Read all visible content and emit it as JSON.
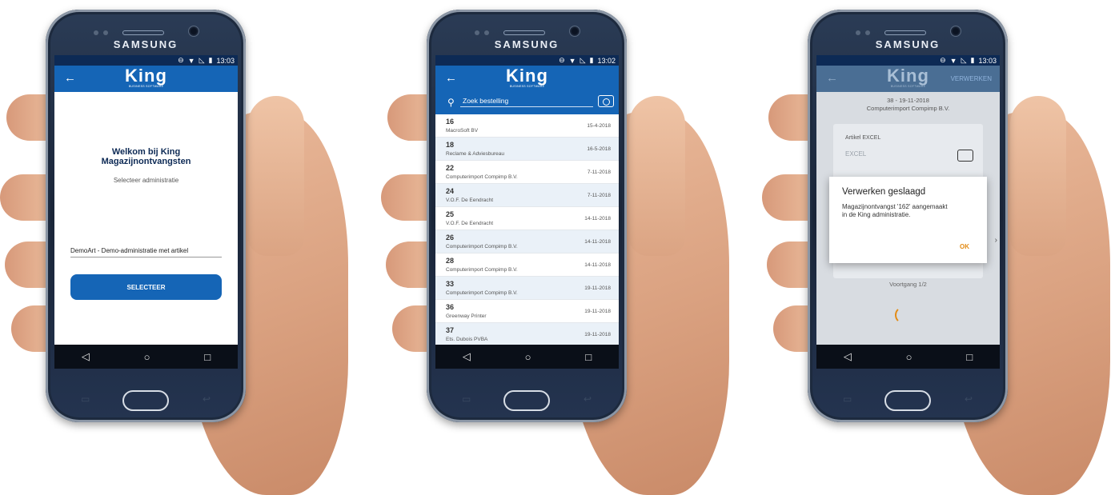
{
  "brand": "SAMSUNG",
  "app_logo": {
    "name": "King",
    "tagline": "BUSINESS SOFTWARE"
  },
  "colors": {
    "appbar": "#1565b6",
    "statusbar": "#0d2a55",
    "accent": "#e38b15",
    "row_alt": "#eaf1f8"
  },
  "icons": {
    "back": "back-arrow-icon",
    "search": "search-icon",
    "camera": "camera-icon"
  },
  "phones": [
    {
      "time": "13:03",
      "welcome_line1": "Welkom bij King",
      "welcome_line2": "Magazijnontvangsten",
      "hint": "Selecteer administratie",
      "selected_admin": "DemoArt - Demo-administratie met artikel",
      "select_button": "SELECTEER"
    },
    {
      "time": "13:02",
      "search_placeholder": "Zoek bestelling",
      "orders": [
        {
          "number": "16",
          "customer": "MacroSoft BV",
          "date": "15-4-2018"
        },
        {
          "number": "18",
          "customer": "Reclame & Adviesbureau",
          "date": "16-5-2018"
        },
        {
          "number": "22",
          "customer": "Computerimport Compimp B.V.",
          "date": "7-11-2018"
        },
        {
          "number": "24",
          "customer": "V.O.F. De Eendracht",
          "date": "7-11-2018"
        },
        {
          "number": "25",
          "customer": "V.O.F. De Eendracht",
          "date": "14-11-2018"
        },
        {
          "number": "26",
          "customer": "Computerimport Compimp B.V.",
          "date": "14-11-2018"
        },
        {
          "number": "28",
          "customer": "Computerimport Compimp B.V.",
          "date": "14-11-2018"
        },
        {
          "number": "33",
          "customer": "Computerimport Compimp B.V.",
          "date": "19-11-2018"
        },
        {
          "number": "36",
          "customer": "Greenway Printer",
          "date": "19-11-2018"
        },
        {
          "number": "37",
          "customer": "Ets. Dubois PVBA",
          "date": "19-11-2018"
        }
      ]
    },
    {
      "time": "13:03",
      "action": "VERWERKEN",
      "order_line": "38 - 19-11-2018",
      "customer": "Computerimport Compimp B.V.",
      "article_label": "Artikel EXCEL",
      "article_value": "EXCEL",
      "progress": "Voortgang 1/2",
      "dialog": {
        "title": "Verwerken geslaagd",
        "message": "Magazijnontvangst '162' aangemaakt in de King administratie.",
        "ok": "OK"
      }
    }
  ]
}
